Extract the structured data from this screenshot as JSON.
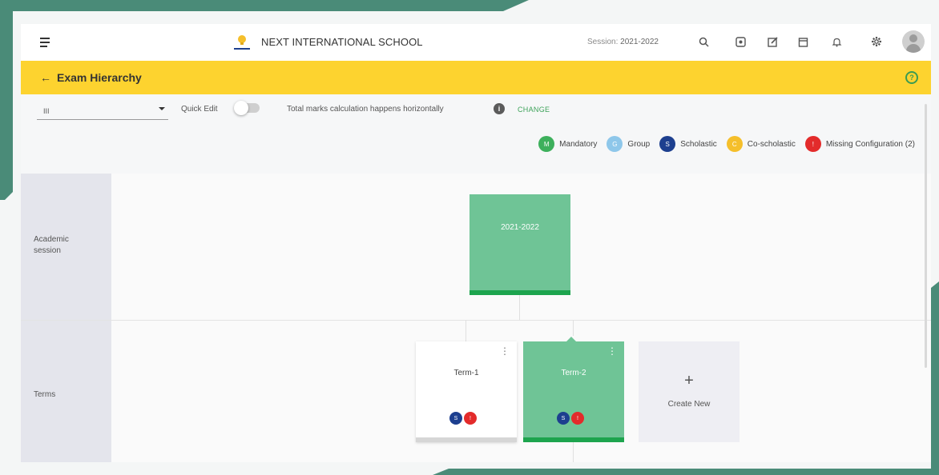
{
  "colors": {
    "frame": "#4a8b78",
    "header_bg": "#fdd32f",
    "mandatory": "#3db05c",
    "group": "#8ec7ea",
    "scholastic": "#1d3f8f",
    "co_scholastic": "#f5bf2b",
    "missing": "#e32b2b",
    "card_green": "#6fc496"
  },
  "topbar": {
    "school_name": "NEXT INTERNATIONAL SCHOOL",
    "session_prefix": "Session:",
    "session_value": "2021-2022",
    "icons": [
      "search-icon",
      "help-box-icon",
      "edit-icon",
      "calendar-icon",
      "bell-icon",
      "gear-icon"
    ]
  },
  "header": {
    "back_icon": "←",
    "title": "Exam Hierarchy",
    "help_icon": "?"
  },
  "controls": {
    "class_value": "III",
    "quick_edit_label": "Quick Edit",
    "quick_edit_on": false,
    "calculation_text": "Total marks calculation happens horizontally",
    "change_label": "CHANGE"
  },
  "legend": [
    {
      "letter": "M",
      "label": "Mandatory"
    },
    {
      "letter": "G",
      "label": "Group"
    },
    {
      "letter": "S",
      "label": "Scholastic"
    },
    {
      "letter": "C",
      "label": "Co-scholastic"
    },
    {
      "letter": "!",
      "label": "Missing Configuration (2)"
    }
  ],
  "board": {
    "rows": {
      "academic_session": "Academic session",
      "terms": "Terms"
    },
    "session_card": {
      "title": "2021-2022"
    },
    "terms": [
      {
        "title": "Term-1",
        "badges": [
          "S",
          "!"
        ]
      },
      {
        "title": "Term-2",
        "badges": [
          "S",
          "!"
        ]
      }
    ],
    "create_new": {
      "plus": "+",
      "label": "Create New"
    }
  }
}
